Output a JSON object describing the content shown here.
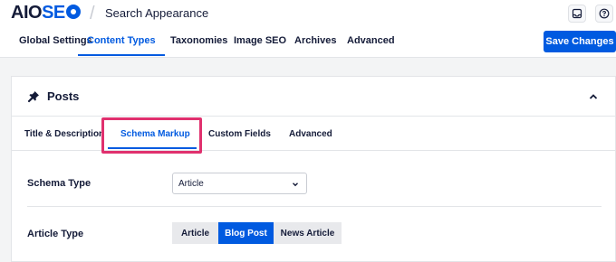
{
  "header": {
    "logo_text": "AIOSEO",
    "page_title": "Search Appearance"
  },
  "nav": {
    "tabs": [
      {
        "label": "Global Settings"
      },
      {
        "label": "Content Types"
      },
      {
        "label": "Taxonomies"
      },
      {
        "label": "Image SEO"
      },
      {
        "label": "Archives"
      },
      {
        "label": "Advanced"
      }
    ],
    "active_tab": "Content Types",
    "save_label": "Save Changes"
  },
  "card": {
    "title": "Posts",
    "subtabs": [
      {
        "label": "Title & Description"
      },
      {
        "label": "Schema Markup"
      },
      {
        "label": "Custom Fields"
      },
      {
        "label": "Advanced"
      }
    ],
    "active_subtab": "Schema Markup",
    "schema_type": {
      "label": "Schema Type",
      "value": "Article"
    },
    "article_type": {
      "label": "Article Type",
      "options": [
        {
          "label": "Article"
        },
        {
          "label": "Blog Post"
        },
        {
          "label": "News Article"
        }
      ],
      "selected": "Blog Post"
    }
  },
  "colors": {
    "accent": "#005ae0",
    "highlight": "#e0306e",
    "text": "#141b38"
  },
  "icons": {
    "inbox": "inbox-icon",
    "help": "help-icon",
    "pin": "pin-icon",
    "collapse": "chevron-up-icon",
    "dropdown": "chevron-down-icon"
  }
}
